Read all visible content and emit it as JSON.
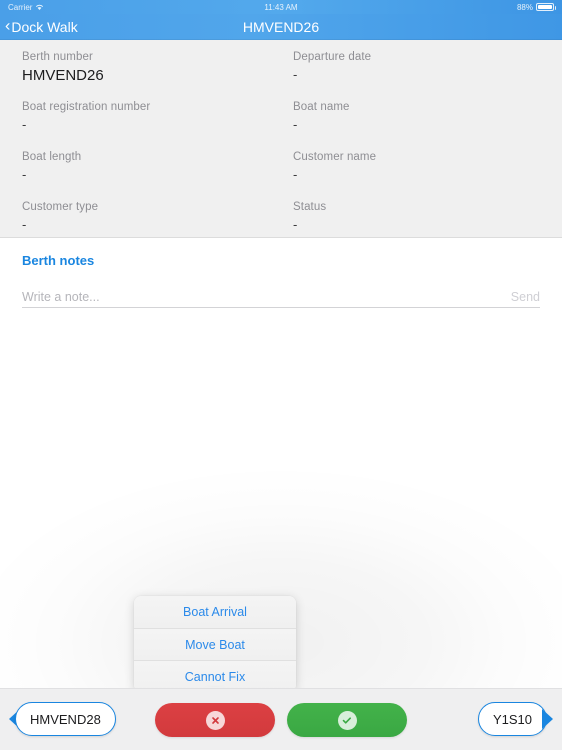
{
  "statusbar": {
    "carrier": "Carrier",
    "wifi_icon": "wifi-icon",
    "time": "11:43 AM",
    "battery_percent": "88%",
    "battery_icon": "battery-icon"
  },
  "navbar": {
    "back_label": "Dock Walk",
    "back_chevron": "‹",
    "title": "HMVEND26"
  },
  "details": {
    "fields": [
      {
        "label": "Berth number",
        "value": "HMVEND26"
      },
      {
        "label": "Departure date",
        "value": "-"
      },
      {
        "label": "Boat registration number",
        "value": "-"
      },
      {
        "label": "Boat name",
        "value": "-"
      },
      {
        "label": "Boat length",
        "value": "-"
      },
      {
        "label": "Customer name",
        "value": "-"
      },
      {
        "label": "Customer type",
        "value": "-"
      },
      {
        "label": "Status",
        "value": "-"
      }
    ]
  },
  "notes": {
    "title": "Berth notes",
    "input_value": "",
    "input_placeholder": "Write a note...",
    "send_label": "Send"
  },
  "popup": {
    "items": [
      {
        "label": "Boat Arrival"
      },
      {
        "label": "Move Boat"
      },
      {
        "label": "Cannot Fix"
      }
    ]
  },
  "toolbar": {
    "prev_berth": "HMVEND28",
    "next_berth": "Y1S10",
    "reject_icon": "x-circle-icon",
    "accept_icon": "check-circle-icon"
  },
  "colors": {
    "nav_blue": "#4a9fe8",
    "accent_blue": "#1a86e0",
    "link_blue": "#2b8aea",
    "reject_red": "#d23a3d",
    "accept_green": "#3aa843",
    "panel_gray": "#f0f0f0",
    "toolbar_gray": "#efeff0"
  }
}
